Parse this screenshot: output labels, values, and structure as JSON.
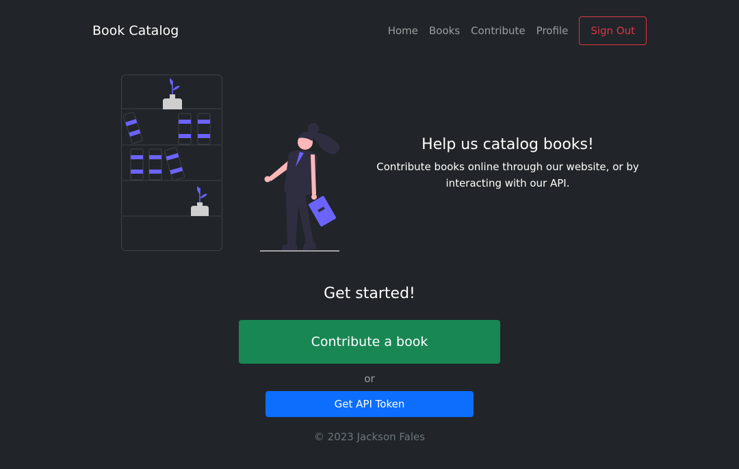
{
  "nav": {
    "brand": "Book Catalog",
    "links": [
      "Home",
      "Books",
      "Contribute",
      "Profile"
    ],
    "signout": "Sign Out"
  },
  "hero": {
    "title": "Help us catalog books!",
    "subtitle": "Contribute books online through our website, or by interacting with our API."
  },
  "cta": {
    "heading": "Get started!",
    "contribute": "Contribute a book",
    "or": "or",
    "api": "Get API Token"
  },
  "footer": "© 2023 Jackson Fales",
  "colors": {
    "background": "#212529",
    "accent": "#6c63ff",
    "success": "#198754",
    "primary": "#0d6efd",
    "danger": "#dc3545"
  }
}
